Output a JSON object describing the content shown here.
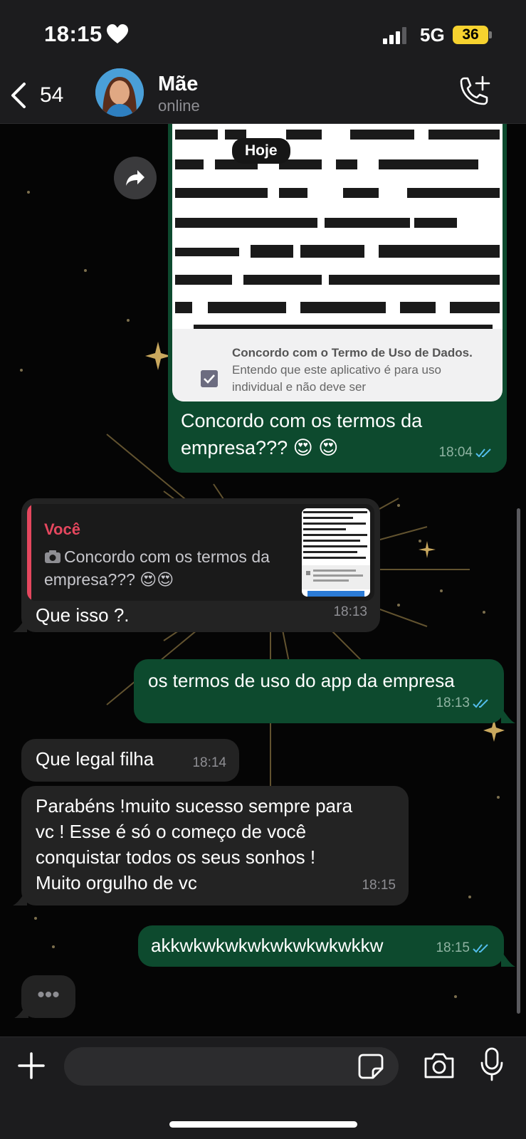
{
  "status_bar": {
    "time": "18:15",
    "network": "5G",
    "battery": "36"
  },
  "header": {
    "back_count": "54",
    "contact_name": "Mãe",
    "contact_status": "online"
  },
  "date_divider": "Hoje",
  "messages": [
    {
      "type": "image",
      "direction": "out",
      "image_checkbox_title": "Concordo com o Termo de Uso de Dados.",
      "image_checkbox_body": "Entendo que este aplicativo é para uso individual e não deve ser",
      "caption": "Concordo com os termos da empresa??? 😍 😍",
      "time": "18:04"
    },
    {
      "type": "reply",
      "direction": "in",
      "quote_author": "Você",
      "quote_text": "Concordo com os termos da empresa??? 😍😍",
      "text": "Que isso ?.",
      "time": "18:13"
    },
    {
      "type": "text",
      "direction": "out",
      "text": "os termos de uso do app da empresa",
      "time": "18:13"
    },
    {
      "type": "text",
      "direction": "in",
      "text": "Que legal  filha",
      "time": "18:14"
    },
    {
      "type": "text",
      "direction": "in",
      "lines": [
        "Parabéns  !muito sucesso sempre para",
        "vc ! Esse é  só  o começo  de você",
        "conquistar todos os seus sonhos !",
        "Muito orgulho de vc"
      ],
      "time": "18:15"
    },
    {
      "type": "text",
      "direction": "out",
      "text": "akkwkwkwkwkwkwkwkwkkw",
      "time": "18:15"
    }
  ],
  "typing_indicator": "•••",
  "colors": {
    "outgoing_bubble": "#0d4a2e",
    "incoming_bubble": "#232323",
    "read_ticks": "#53bdeb",
    "quote_accent": "#e5475e",
    "battery": "#f6d22f"
  },
  "icons": [
    "heart-icon",
    "signal-icon",
    "back-chevron-icon",
    "call-add-icon",
    "forward-icon",
    "plus-icon",
    "sticker-icon",
    "camera-icon",
    "microphone-icon"
  ]
}
